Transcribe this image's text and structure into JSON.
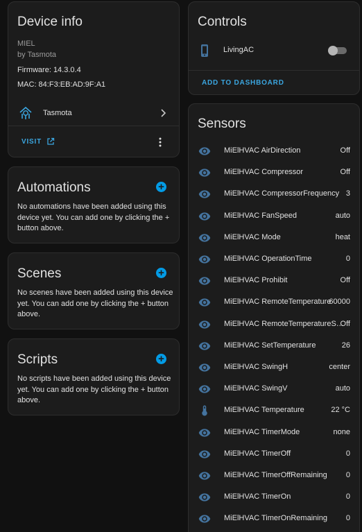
{
  "device_info": {
    "title": "Device info",
    "model": "MIEL",
    "manufacturer": "by Tasmota",
    "firmware": "Firmware: 14.3.0.4",
    "mac": "MAC: 84:F3:EB:AD:9F:A1",
    "integration": "Tasmota",
    "visit_label": "VISIT"
  },
  "automations": {
    "title": "Automations",
    "empty_text": "No automations have been added using this device yet. You can add one by clicking the + button above."
  },
  "scenes": {
    "title": "Scenes",
    "empty_text": "No scenes have been added using this device yet. You can add one by clicking the + button above."
  },
  "scripts": {
    "title": "Scripts",
    "empty_text": "No scripts have been added using this device yet. You can add one by clicking the + button above."
  },
  "controls": {
    "title": "Controls",
    "entity": "LivingAC",
    "toggle_state": "off",
    "add_to_dashboard": "ADD TO DASHBOARD"
  },
  "sensors": {
    "title": "Sensors",
    "items": [
      {
        "name": "MiElHVAC AirDirection",
        "value": "Off",
        "icon": "eye-icon"
      },
      {
        "name": "MiElHVAC Compressor",
        "value": "Off",
        "icon": "eye-icon"
      },
      {
        "name": "MiElHVAC CompressorFrequency",
        "value": "3",
        "icon": "eye-icon"
      },
      {
        "name": "MiElHVAC FanSpeed",
        "value": "auto",
        "icon": "eye-icon"
      },
      {
        "name": "MiElHVAC Mode",
        "value": "heat",
        "icon": "eye-icon"
      },
      {
        "name": "MiElHVAC OperationTime",
        "value": "0",
        "icon": "eye-icon"
      },
      {
        "name": "MiElHVAC Prohibit",
        "value": "Off",
        "icon": "eye-icon"
      },
      {
        "name": "MiElHVAC RemoteTemperature",
        "value": "60000",
        "icon": "eye-icon"
      },
      {
        "name": "MiElHVAC RemoteTemperatureSensorState",
        "value": "Off",
        "icon": "eye-icon"
      },
      {
        "name": "MiElHVAC SetTemperature",
        "value": "26",
        "icon": "eye-icon"
      },
      {
        "name": "MiElHVAC SwingH",
        "value": "center",
        "icon": "eye-icon"
      },
      {
        "name": "MiElHVAC SwingV",
        "value": "auto",
        "icon": "eye-icon"
      },
      {
        "name": "MiElHVAC Temperature",
        "value": "22 °C",
        "icon": "thermometer-icon"
      },
      {
        "name": "MiElHVAC TimerMode",
        "value": "none",
        "icon": "eye-icon"
      },
      {
        "name": "MiElHVAC TimerOff",
        "value": "0",
        "icon": "eye-icon"
      },
      {
        "name": "MiElHVAC TimerOffRemaining",
        "value": "0",
        "icon": "eye-icon"
      },
      {
        "name": "MiElHVAC TimerOn",
        "value": "0",
        "icon": "eye-icon"
      },
      {
        "name": "MiElHVAC TimerOnRemaining",
        "value": "0",
        "icon": "eye-icon"
      }
    ]
  },
  "colors": {
    "background": "#111111",
    "card": "#1c1c1c",
    "accent": "#039be5",
    "icon": "#44739e"
  }
}
